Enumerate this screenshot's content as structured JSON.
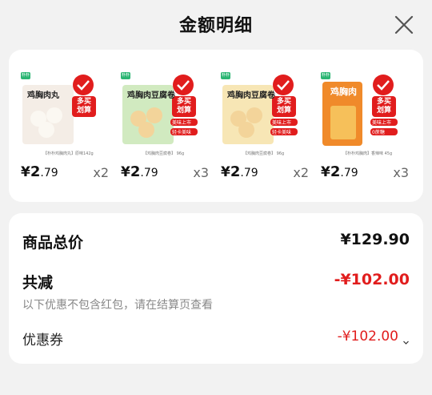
{
  "header": {
    "title": "金额明细",
    "close_icon": "close-icon"
  },
  "products": [
    {
      "name": "鸡胸肉丸",
      "brand": "朴朴",
      "badge": "多买划算",
      "tag1": "",
      "tag2": "",
      "caption": "【朴朴鸡胸肉丸】原味142g",
      "currency": "¥",
      "price_int": "2",
      "price_dec": ".79",
      "qty": "x2",
      "theme": "#f4ede6"
    },
    {
      "name": "鸡胸肉豆腐卷",
      "brand": "朴朴",
      "badge": "多买划算",
      "tag1": "美味上市",
      "tag2": "轻卡美味",
      "caption": "【鸡胸肉豆腐卷】 96g",
      "currency": "¥",
      "price_int": "2",
      "price_dec": ".79",
      "qty": "x3",
      "theme": "#7cc24a"
    },
    {
      "name": "鸡胸肉豆腐卷",
      "brand": "朴朴",
      "badge": "多买划算",
      "tag1": "美味上市",
      "tag2": "轻卡美味",
      "caption": "【鸡胸肉豆腐卷】 96g",
      "currency": "¥",
      "price_int": "2",
      "price_dec": ".79",
      "qty": "x2",
      "theme": "#e9b62c"
    },
    {
      "name": "鸡胸肉",
      "brand": "朴朴",
      "badge": "多买划算",
      "tag1": "美味上市",
      "tag2": "0蔗糖",
      "caption": "【朴朴鸡胸肉】香辣味 45g",
      "currency": "¥",
      "price_int": "2",
      "price_dec": ".79",
      "qty": "x3",
      "theme": "#f08a2a"
    }
  ],
  "summary": {
    "total_label": "商品总价",
    "total_value": "¥129.90",
    "discount_label": "共减",
    "discount_value": "-¥102.00",
    "note": "以下优惠不包含红包，请在结算页查看",
    "coupon_label": "优惠券",
    "coupon_value": "-¥102.00"
  },
  "colors": {
    "accent_red": "#e11d1d",
    "background": "#f2f2f2",
    "card": "#ffffff"
  }
}
